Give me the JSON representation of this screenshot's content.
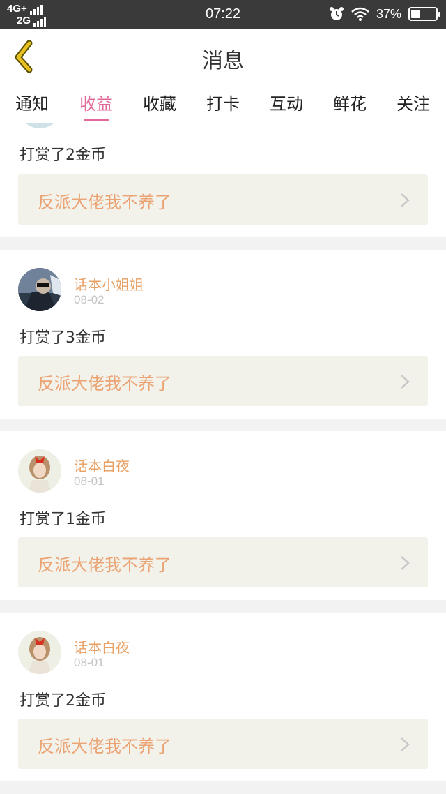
{
  "status_bar": {
    "network_line1": "4G+",
    "network_line2": "2G",
    "time": "07:22",
    "battery_text": "37%",
    "battery_level": 0.37
  },
  "nav": {
    "title": "消息",
    "back_icon": "chevron-left-icon"
  },
  "tabs": [
    {
      "label": "通知",
      "active": false
    },
    {
      "label": "收益",
      "active": true
    },
    {
      "label": "收藏",
      "active": false
    },
    {
      "label": "打卡",
      "active": false
    },
    {
      "label": "互动",
      "active": false
    },
    {
      "label": "鲜花",
      "active": false
    },
    {
      "label": "关注",
      "active": false
    }
  ],
  "items": [
    {
      "reward": "打赏了2金币",
      "book": "反派大佬我不养了"
    },
    {
      "user": "话本小姐姐",
      "date": "08-02",
      "reward": "打赏了3金币",
      "book": "反派大佬我不养了"
    },
    {
      "user": "话本白夜",
      "date": "08-01",
      "reward": "打赏了1金币",
      "book": "反派大佬我不养了"
    },
    {
      "user": "话本白夜",
      "date": "08-01",
      "reward": "打赏了2金币",
      "book": "反派大佬我不养了"
    }
  ],
  "colors": {
    "accent": "#e0689a",
    "username": "#e8a064",
    "book_title": "#eba373",
    "book_bg": "#f2f1ea",
    "back_icon": "#e8c020"
  }
}
